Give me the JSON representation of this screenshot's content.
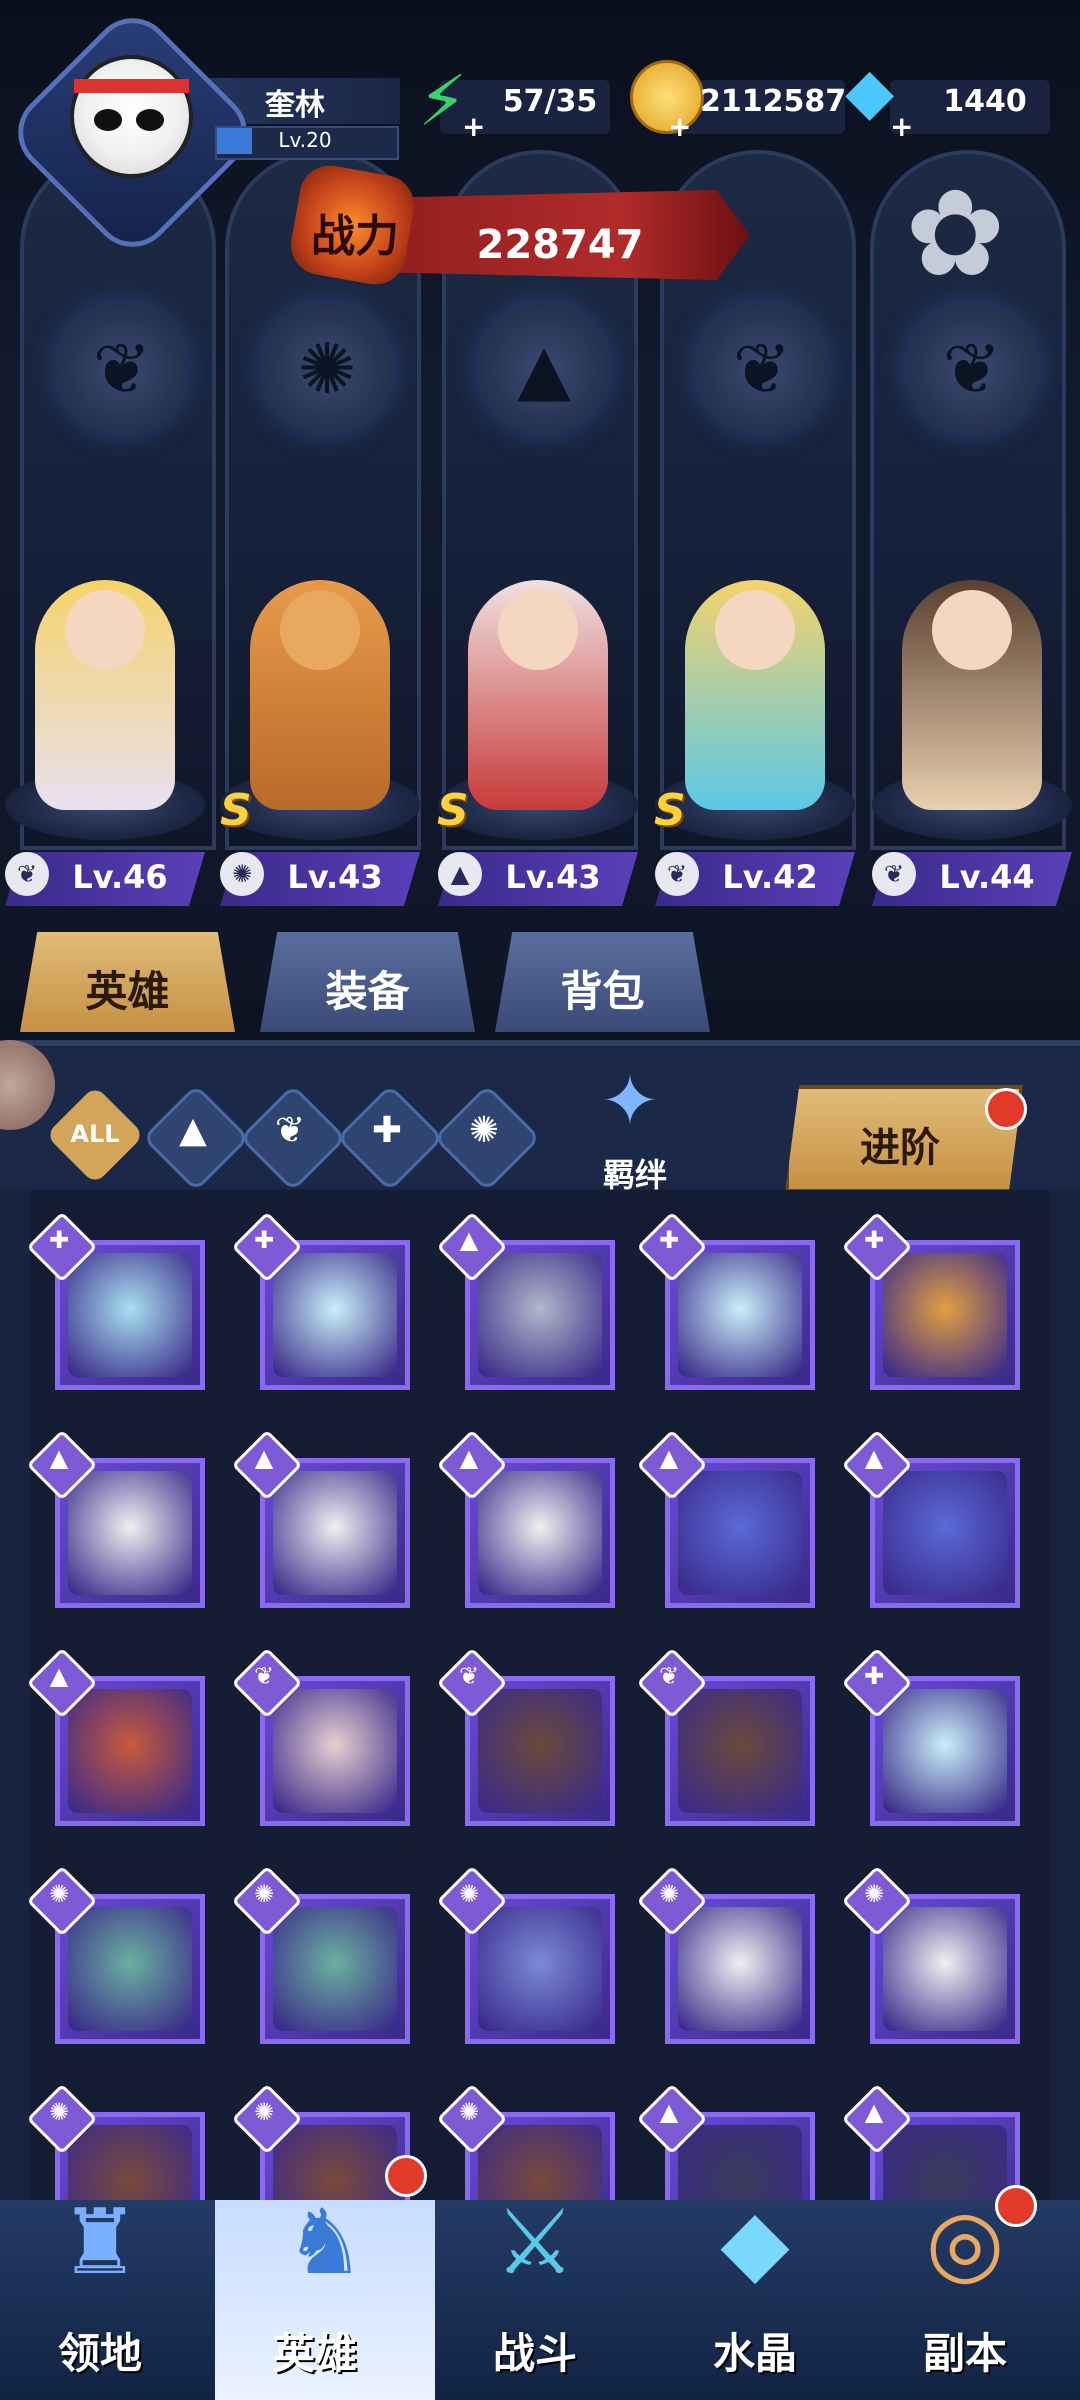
{
  "player": {
    "name": "奎林",
    "level": "Lv.20",
    "level_progress": 0.2
  },
  "resources": {
    "energy": "57/35",
    "gold": "2112587",
    "gems": "1440"
  },
  "power": {
    "label": "战力",
    "value": "228747"
  },
  "heroes": [
    {
      "level": "Lv.46",
      "class_icon": "wing-icon",
      "rank": ""
    },
    {
      "level": "Lv.43",
      "class_icon": "beast-icon",
      "rank": "S"
    },
    {
      "level": "Lv.43",
      "class_icon": "mage-icon",
      "rank": "S"
    },
    {
      "level": "Lv.42",
      "class_icon": "wing-icon",
      "rank": "S"
    },
    {
      "level": "Lv.44",
      "class_icon": "wing-icon",
      "rank": ""
    }
  ],
  "tabs": {
    "hero": "英雄",
    "equipment": "装备",
    "bag": "背包"
  },
  "filters": {
    "all": "ALL",
    "bond": "羁绊",
    "advance": "进阶"
  },
  "nav": {
    "territory": "领地",
    "hero": "英雄",
    "battle": "战斗",
    "crystal": "水晶",
    "dungeon": "副本"
  },
  "colors": {
    "accent_gold": "#d4a45a",
    "card_purple": "#6a4ad8",
    "power_red": "#b12b2b"
  }
}
